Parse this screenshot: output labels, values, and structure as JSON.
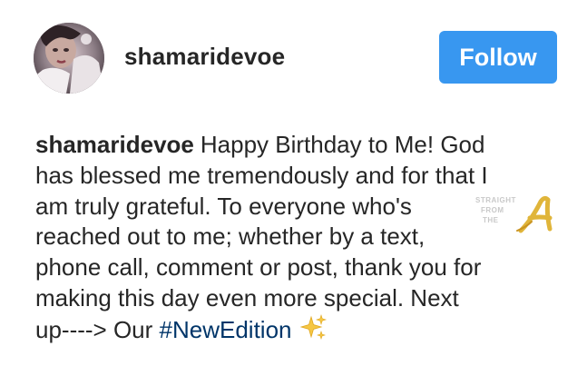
{
  "header": {
    "username": "shamaridevoe",
    "follow_label": "Follow"
  },
  "caption": {
    "author": "shamaridevoe",
    "lines": [
      "Happy Birthday to Me! God",
      "has blessed me tremendously and for that I",
      "am truly grateful. To everyone who's",
      "reached out to me; whether by a text,",
      "phone call, comment or post, thank you for",
      "making this day even more special. Next",
      "up----> Our "
    ],
    "hashtag": "#NewEdition",
    "emoji": "sparkles-icon"
  },
  "watermark": {
    "line1": "STRAIGHT",
    "line2": "FROM",
    "line3": "THE",
    "logo_letter": "A"
  },
  "colors": {
    "follow_button_bg": "#3897f0",
    "hashtag": "#003569",
    "text": "#262626",
    "watermark_gold": "#e0b53a"
  }
}
